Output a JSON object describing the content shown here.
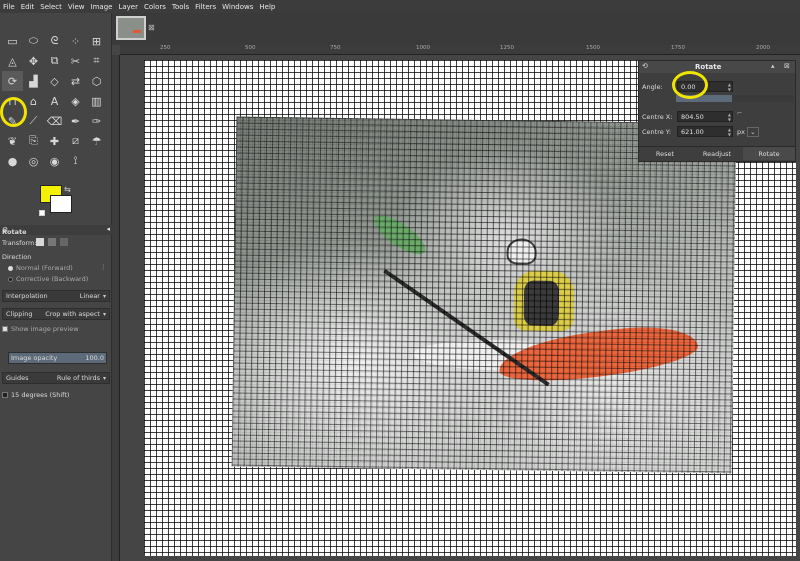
{
  "menu": [
    "File",
    "Edit",
    "Select",
    "View",
    "Image",
    "Layer",
    "Colors",
    "Tools",
    "Filters",
    "Windows",
    "Help"
  ],
  "tab": {
    "close_glyph": "⊠"
  },
  "ruler": {
    "labels": [
      "250",
      "500",
      "750",
      "1000",
      "1250",
      "1500",
      "1750",
      "2000"
    ]
  },
  "tool_options": {
    "title": "Rotate",
    "transform_label": "Transform:",
    "direction_label": "Direction",
    "direction_normal": "Normal (Forward)",
    "direction_corrective": "Corrective (Backward)",
    "interpolation_label": "Interpolation",
    "interpolation_value": "Linear",
    "clipping_label": "Clipping",
    "clipping_value": "Crop with aspect",
    "show_preview": "Show image preview",
    "opacity_label": "Image opacity",
    "opacity_value": "100.0",
    "guides_label": "Guides",
    "guides_value": "Rule of thirds",
    "constrain": "15 degrees (Shift)"
  },
  "colors": {
    "foreground": "#f5f000",
    "background": "#ffffff",
    "highlight": "#f0e400"
  },
  "rotate_dialog": {
    "title": "Rotate",
    "angle_label": "Angle:",
    "angle_value": "0.00",
    "centre_x_label": "Centre X:",
    "centre_x_value": "804.50",
    "centre_y_label": "Centre Y:",
    "centre_y_value": "621.00",
    "unit": "px",
    "reset": "Reset",
    "readjust": "Readjust",
    "rotate": "Rotate"
  }
}
